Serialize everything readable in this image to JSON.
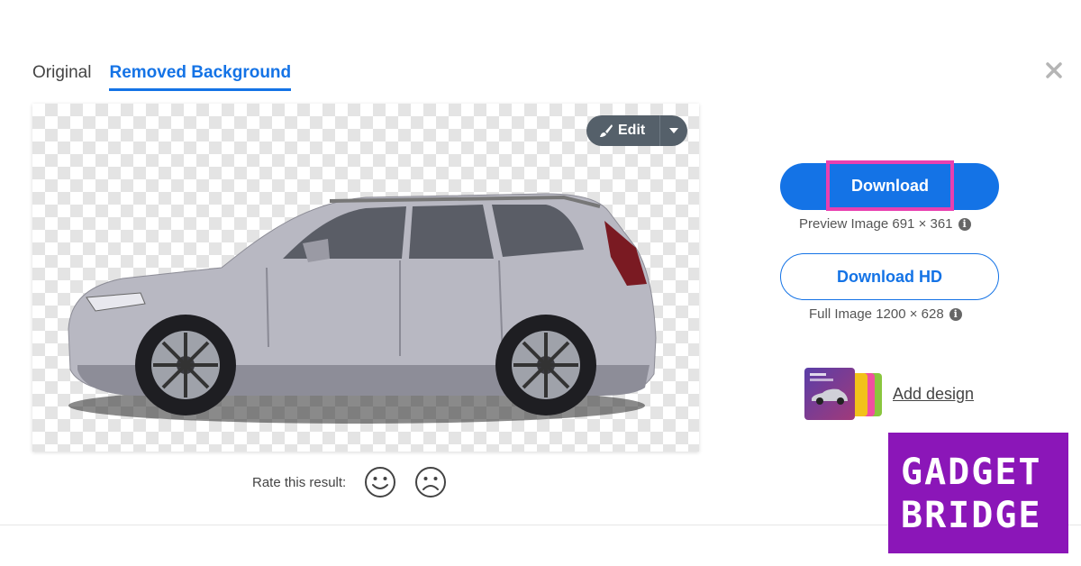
{
  "tabs": [
    {
      "label": "Original",
      "active": false
    },
    {
      "label": "Removed Background",
      "active": true
    }
  ],
  "edit": {
    "label": "Edit"
  },
  "rating": {
    "label": "Rate this result:"
  },
  "download": {
    "label": "Download",
    "preview_text": "Preview Image 691 × 361"
  },
  "download_hd": {
    "label": "Download HD",
    "full_text": "Full Image 1200 × 628"
  },
  "add_design": {
    "label": "Add design"
  },
  "watermark": {
    "line1": "GADGET",
    "line2": "BRIDGE"
  },
  "colors": {
    "accent": "#1473e6",
    "highlight": "#e940b0",
    "watermark_bg": "#8b16b8",
    "edit_bg": "#55606a"
  }
}
